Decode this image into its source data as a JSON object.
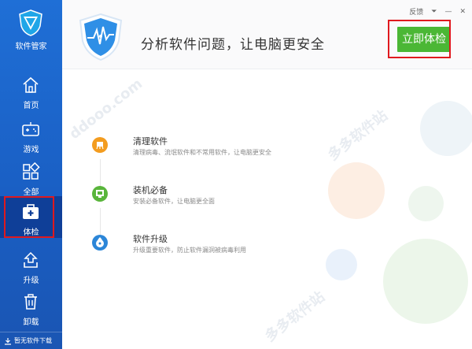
{
  "sidebar": {
    "logo_text": "软件管家",
    "items": [
      {
        "label": "首页",
        "icon": "home-icon"
      },
      {
        "label": "游戏",
        "icon": "gamepad-icon"
      },
      {
        "label": "全部",
        "icon": "grid-icon"
      },
      {
        "label": "体检",
        "icon": "medical-kit-icon",
        "active": true
      },
      {
        "label": "升级",
        "icon": "upload-icon"
      },
      {
        "label": "卸载",
        "icon": "trash-icon"
      }
    ],
    "bottom_text": "暂无软件下载"
  },
  "header": {
    "headline": "分析软件问题，让电脑更安全",
    "scan_button": "立即体检",
    "feedback": "反馈",
    "menu_glyph": "⏷",
    "minimize_glyph": "—",
    "close_glyph": "✕"
  },
  "features": [
    {
      "title": "清理软件",
      "desc": "清理病毒、流氓软件和不常用软件，让电脑更安全",
      "icon": "broom-icon",
      "color": "#f39c1f"
    },
    {
      "title": "装机必备",
      "desc": "安装必备软件，让电脑更全面",
      "icon": "monitor-icon",
      "color": "#59b53b"
    },
    {
      "title": "软件升级",
      "desc": "升级重要软件，防止软件漏洞被病毒利用",
      "icon": "disc-upgrade-icon",
      "color": "#2c86d8"
    }
  ],
  "watermark": "多多软件站",
  "colors": {
    "sidebar": "#1a5fc4",
    "active": "#0f3f98",
    "accent_green": "#4bb735",
    "highlight_red": "#e0191e"
  }
}
